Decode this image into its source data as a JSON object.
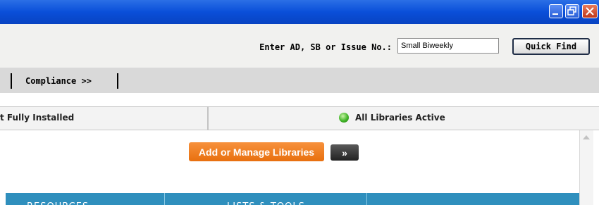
{
  "window": {
    "minimize_icon": "minimize-icon",
    "maximize_icon": "restore-icon",
    "close_icon": "close-icon"
  },
  "header": {
    "find_label": "Enter AD, SB or Issue No.:",
    "find_value": "Small Biweekly",
    "find_button": "Quick Find"
  },
  "tabs": {
    "compliance": "Compliance >>"
  },
  "status": {
    "left_text": "t Fully Installed",
    "right_text": "All Libraries Active",
    "right_icon": "green-status-dot-icon"
  },
  "main": {
    "manage_button": "Add or Manage Libraries",
    "go_button": "»"
  },
  "bluebar": {
    "col1": "RESOURCES",
    "col2": "LISTS & TOOLS"
  },
  "colors": {
    "titlebar": "#0a4fd9",
    "accent_orange": "#f07d1e",
    "bluebar": "#2f8fbd",
    "status_green": "#41b528"
  }
}
